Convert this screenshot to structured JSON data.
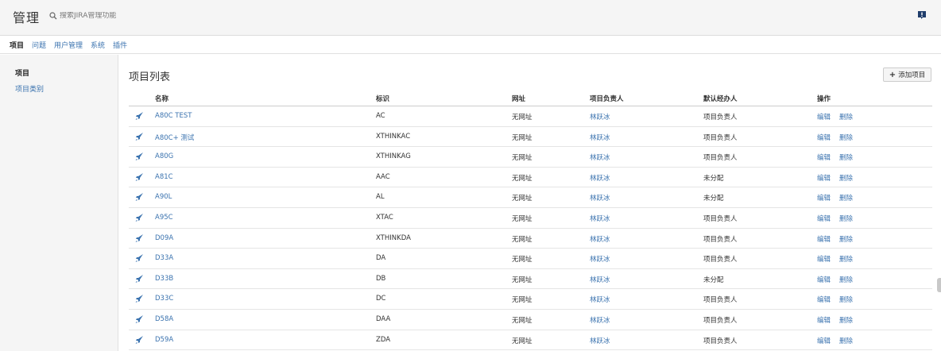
{
  "header": {
    "title": "管理",
    "search_placeholder": "搜索JIRA管理功能"
  },
  "tabs": [
    {
      "label": "项目",
      "active": true
    },
    {
      "label": "问题",
      "active": false
    },
    {
      "label": "用户管理",
      "active": false
    },
    {
      "label": "系统",
      "active": false
    },
    {
      "label": "插件",
      "active": false
    }
  ],
  "sidebar": {
    "items": [
      {
        "label": "项目",
        "active": true
      },
      {
        "label": "项目类别",
        "active": false
      }
    ]
  },
  "main": {
    "title": "项目列表",
    "add_label": "添加项目"
  },
  "table": {
    "columns": [
      "名称",
      "标识",
      "网址",
      "项目负责人",
      "默认经办人",
      "操作"
    ],
    "action_edit": "编辑",
    "action_delete": "删除",
    "rows": [
      {
        "name": "A80C TEST",
        "key": "AC",
        "url": "无网址",
        "lead": "林跃冰",
        "assignee": "项目负责人"
      },
      {
        "name": "A80C+ 测试",
        "key": "XTHINKAC",
        "url": "无网址",
        "lead": "林跃冰",
        "assignee": "项目负责人"
      },
      {
        "name": "A80G",
        "key": "XTHINKAG",
        "url": "无网址",
        "lead": "林跃冰",
        "assignee": "项目负责人"
      },
      {
        "name": "A81C",
        "key": "AAC",
        "url": "无网址",
        "lead": "林跃冰",
        "assignee": "未分配"
      },
      {
        "name": "A90L",
        "key": "AL",
        "url": "无网址",
        "lead": "林跃冰",
        "assignee": "未分配"
      },
      {
        "name": "A95C",
        "key": "XTAC",
        "url": "无网址",
        "lead": "林跃冰",
        "assignee": "项目负责人"
      },
      {
        "name": "D09A",
        "key": "XTHINKDA",
        "url": "无网址",
        "lead": "林跃冰",
        "assignee": "项目负责人"
      },
      {
        "name": "D33A",
        "key": "DA",
        "url": "无网址",
        "lead": "林跃冰",
        "assignee": "项目负责人"
      },
      {
        "name": "D33B",
        "key": "DB",
        "url": "无网址",
        "lead": "林跃冰",
        "assignee": "未分配"
      },
      {
        "name": "D33C",
        "key": "DC",
        "url": "无网址",
        "lead": "林跃冰",
        "assignee": "项目负责人"
      },
      {
        "name": "D58A",
        "key": "DAA",
        "url": "无网址",
        "lead": "林跃冰",
        "assignee": "项目负责人"
      },
      {
        "name": "D59A",
        "key": "ZDA",
        "url": "无网址",
        "lead": "林跃冰",
        "assignee": "项目负责人"
      }
    ]
  },
  "icons": {
    "search": "search-icon",
    "help": "help-icon",
    "project": "rocket-icon",
    "add": "plus-icon"
  },
  "colors": {
    "link": "#3b73af",
    "header_bg": "#f5f5f5",
    "project_icon": "#3b73af"
  }
}
